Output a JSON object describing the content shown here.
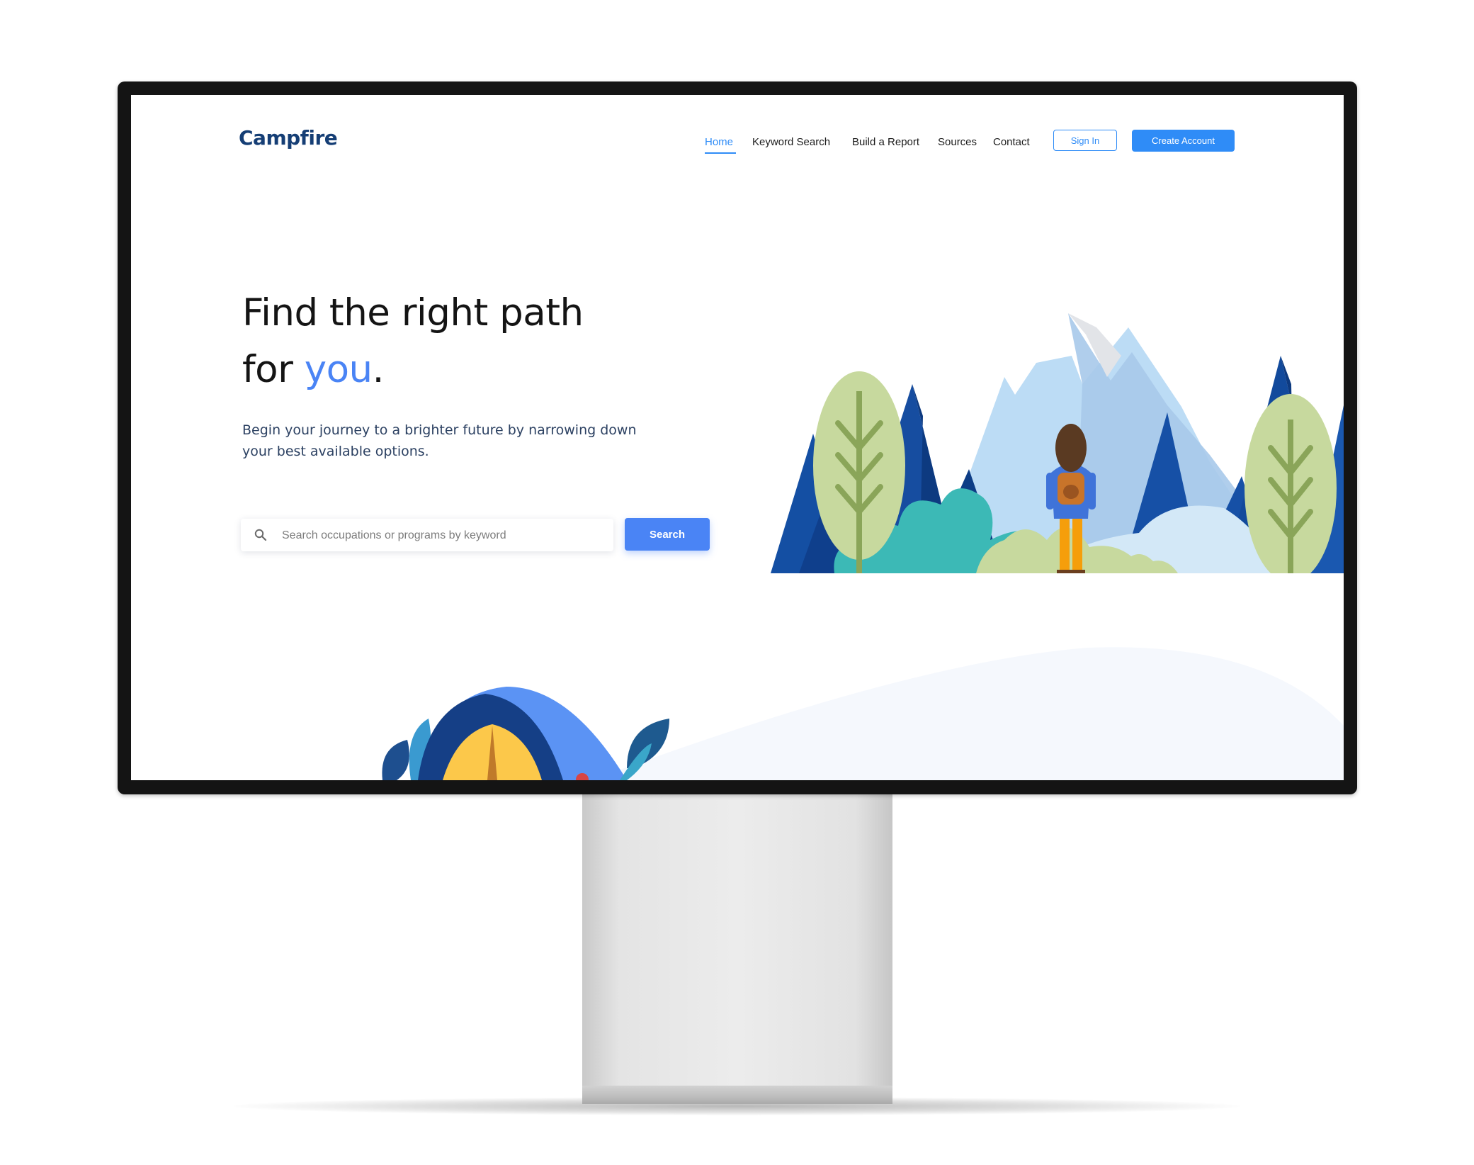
{
  "site": {
    "logo": "Campfire"
  },
  "nav": {
    "links": [
      "Home",
      "Keyword Search",
      "Build a Report",
      "Sources",
      "Contact"
    ],
    "active": "Home",
    "signin_label": "Sign In",
    "create_label": "Create Account"
  },
  "hero": {
    "title_line1": "Find the right path",
    "title_line2_prefix": "for ",
    "title_accent": "you",
    "title_suffix": ".",
    "subtitle_line1": "Begin your journey to a brighter future by narrowing down",
    "subtitle_line2": "your best available options."
  },
  "search": {
    "placeholder": "Search occupations or programs by keyword",
    "value": "",
    "button_label": "Search"
  },
  "colors": {
    "brand": "#153e75",
    "accent": "#2f8cf7",
    "hero_accent": "#4a84f5"
  }
}
